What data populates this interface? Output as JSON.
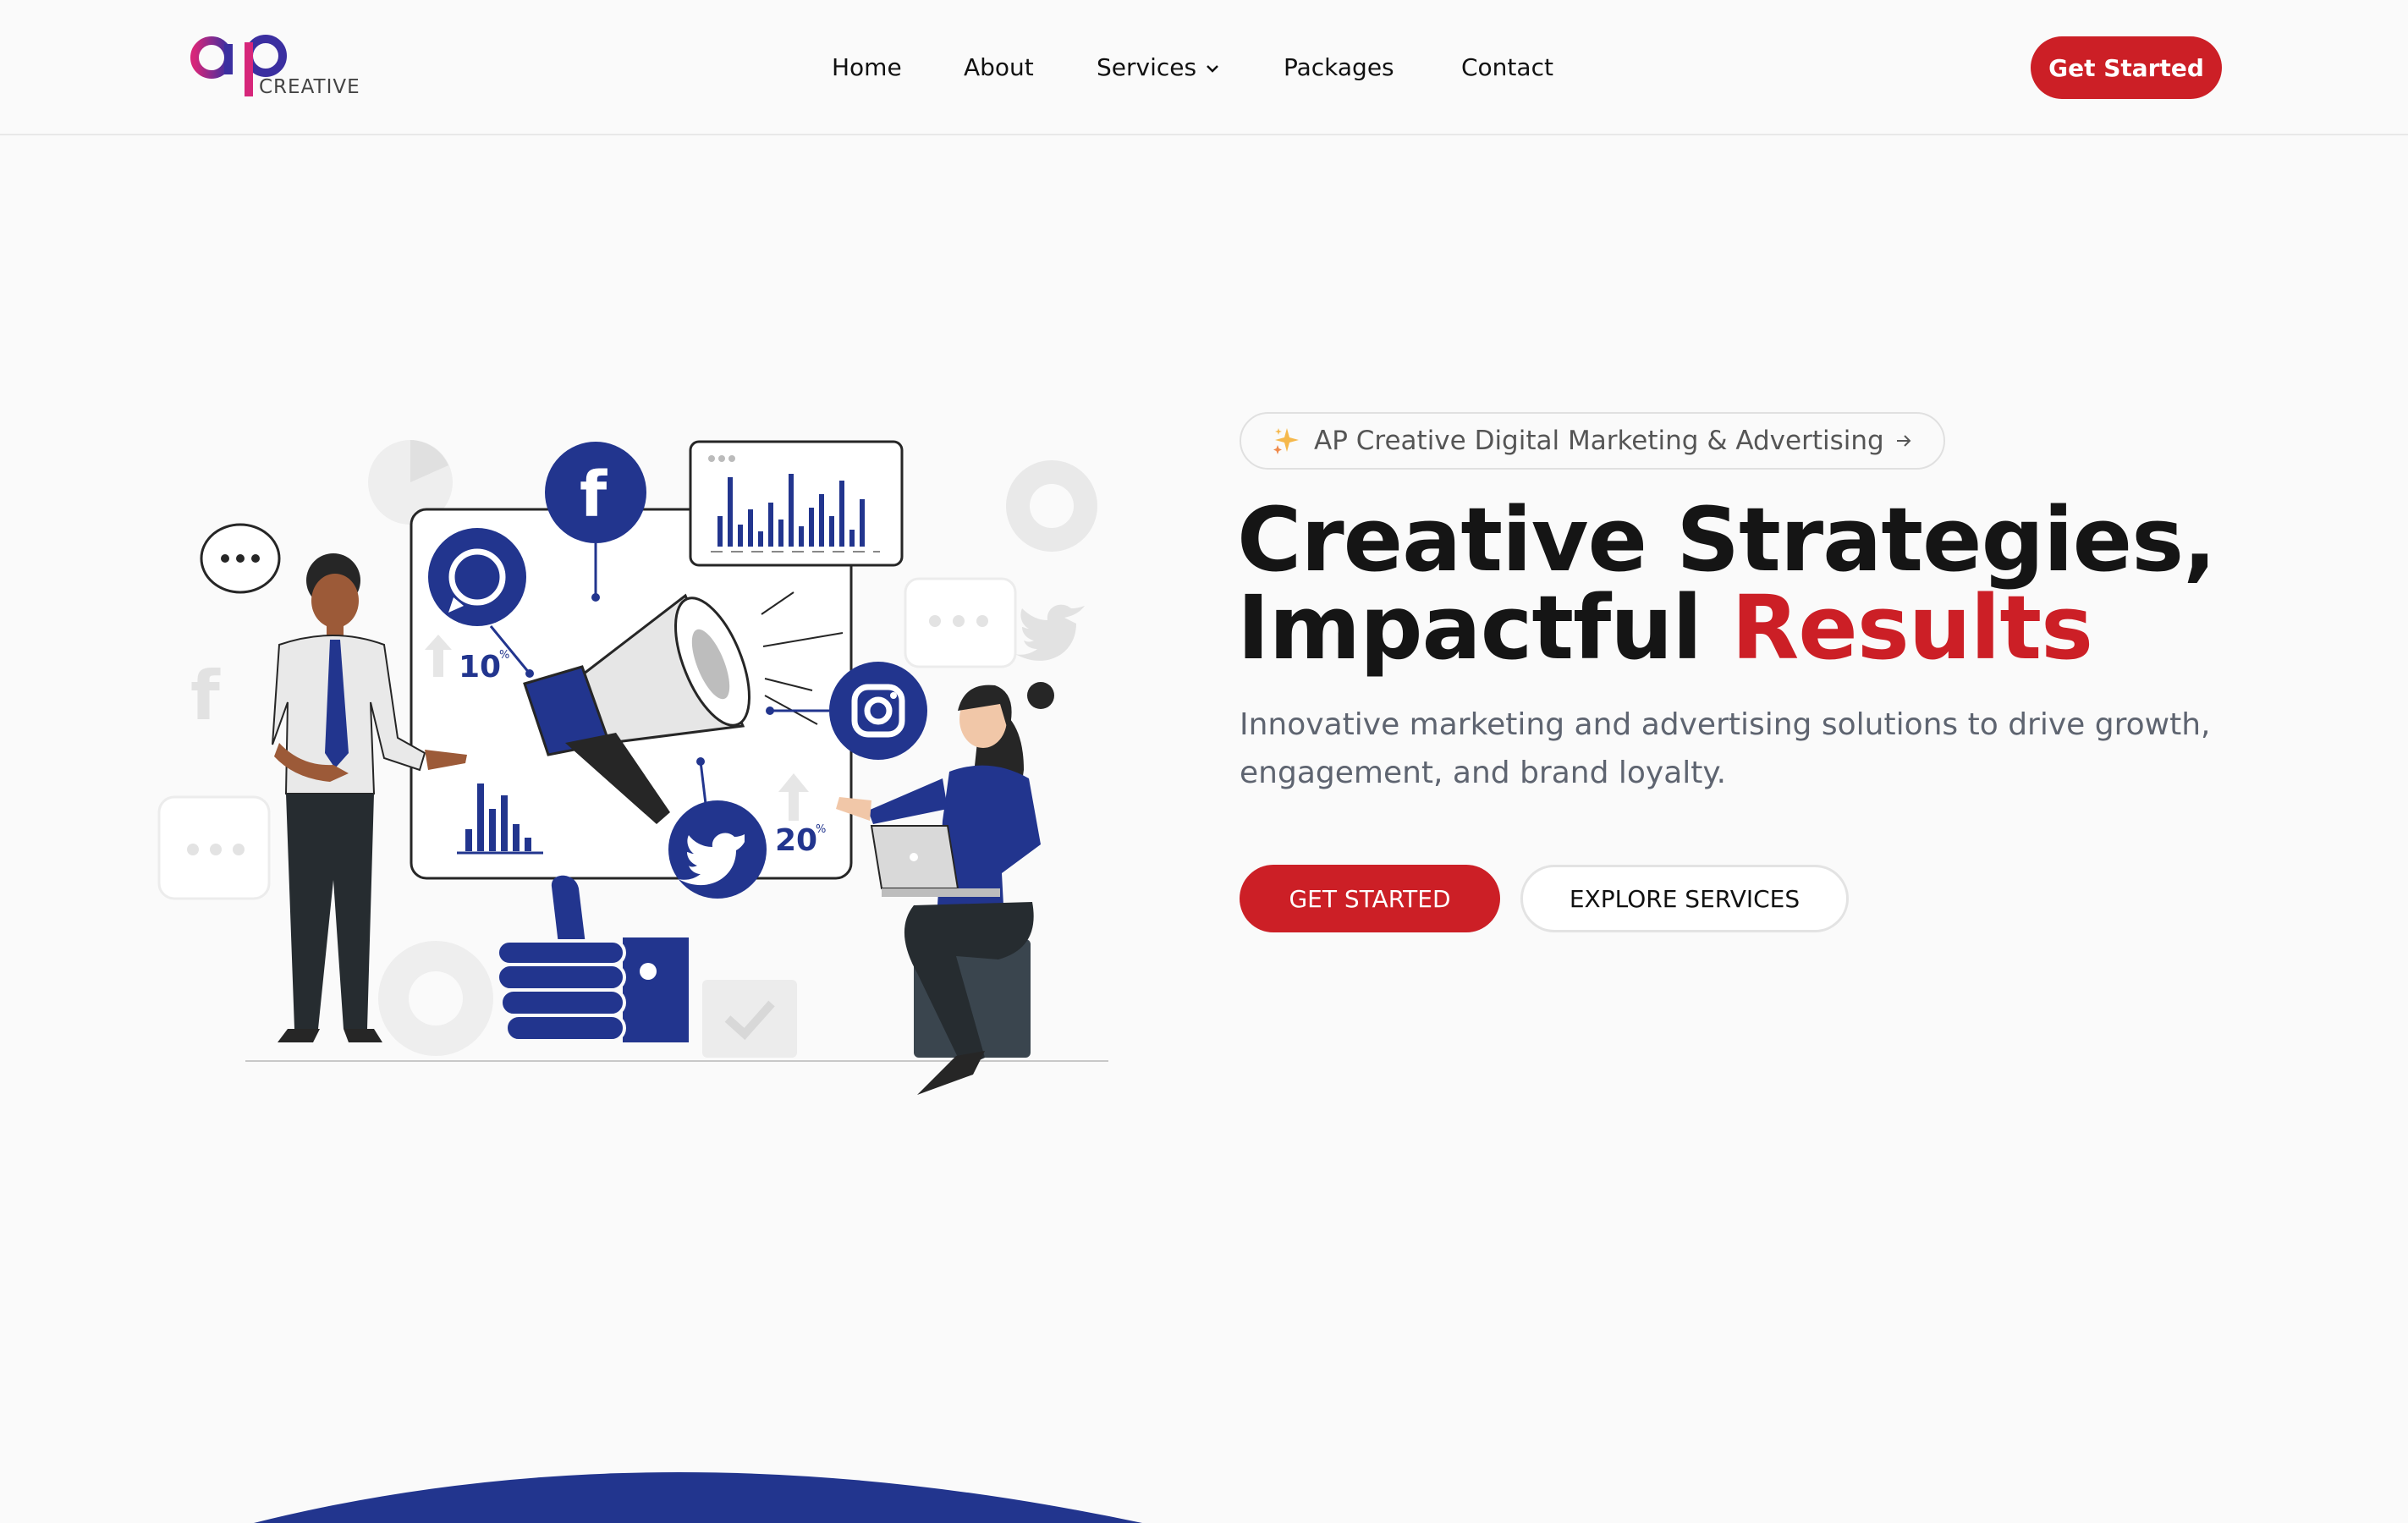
{
  "brand": {
    "logo_mark": "ap",
    "logo_text": "CREATIVE",
    "colors": {
      "accent": "#cc1f26",
      "navy": "#22358e",
      "logo_gradient": [
        "#d6267a",
        "#3b2fa0"
      ]
    }
  },
  "nav": {
    "items": [
      {
        "label": "Home"
      },
      {
        "label": "About"
      },
      {
        "label": "Services",
        "icon": "chevron-down-icon"
      },
      {
        "label": "Packages"
      },
      {
        "label": "Contact"
      }
    ],
    "cta_label": "Get Started"
  },
  "hero": {
    "badge": {
      "icon": "sparkles-icon",
      "text": "AP Creative Digital Marketing & Advertising",
      "arrow_icon": "arrow-right-icon"
    },
    "headline": {
      "line1": "Creative Strategies,",
      "line2_plain": "Impactful",
      "line2_accent": "Results"
    },
    "subtitle": "Innovative marketing and advertising solutions to drive growth, engagement, and brand loyalty.",
    "primary_button": "GET STARTED",
    "secondary_button": "EXPLORE SERVICES",
    "illustration": {
      "stat_left": "10",
      "stat_right": "20",
      "stat_suffix": "%",
      "icons": [
        "facebook-icon",
        "whatsapp-icon",
        "instagram-icon",
        "twitter-icon",
        "megaphone-icon",
        "thumbs-up-icon",
        "laptop-icon",
        "bar-chart-icon"
      ]
    }
  }
}
